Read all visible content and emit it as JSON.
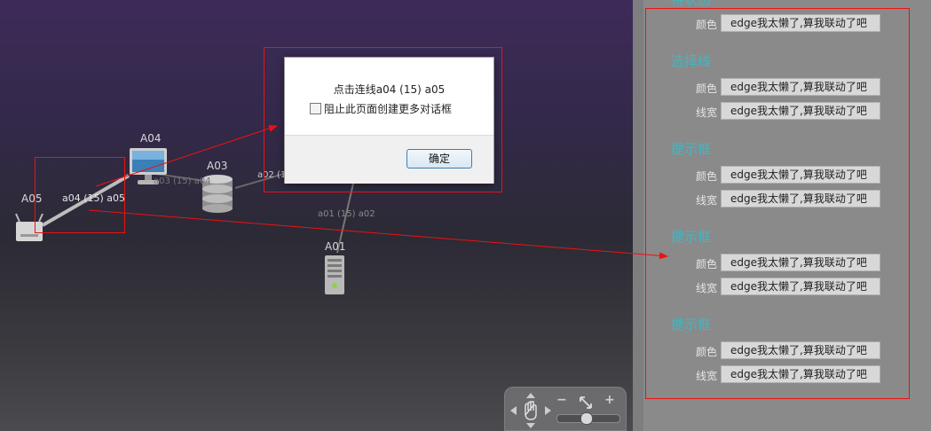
{
  "topology": {
    "nodes": [
      {
        "id": "A04",
        "label": "A04",
        "icon": "monitor-icon"
      },
      {
        "id": "A03",
        "label": "A03",
        "icon": "database-icon"
      },
      {
        "id": "A05",
        "label": "A05",
        "icon": "router-icon"
      },
      {
        "id": "A01",
        "label": "A01",
        "icon": "server-icon"
      }
    ],
    "links": {
      "a04_a05": "a04 (15) a05",
      "a03_a04": "a03 (15) a04",
      "a02_partial": "a02 (1",
      "a01_a02": "a01 (15) a02"
    },
    "zoom": {
      "minus": "−",
      "plus": "+",
      "level": 0.45
    }
  },
  "dialog": {
    "message": "点击连线a04 (15) a05",
    "checkbox_label": "阻止此页面创建更多对话框",
    "ok_label": "确定"
  },
  "panel": {
    "top_partial_title": "待状态",
    "rows_group0": [
      {
        "label": "颜色",
        "value": "edge我太懒了,算我联动了吧"
      }
    ],
    "groups": [
      {
        "title": "选择线",
        "rows": [
          {
            "label": "颜色",
            "value": "edge我太懒了,算我联动了吧"
          },
          {
            "label": "线宽",
            "value": "edge我太懒了,算我联动了吧"
          }
        ]
      },
      {
        "title": "提示框",
        "rows": [
          {
            "label": "颜色",
            "value": "edge我太懒了,算我联动了吧"
          },
          {
            "label": "线宽",
            "value": "edge我太懒了,算我联动了吧"
          }
        ]
      },
      {
        "title": "提示框",
        "rows": [
          {
            "label": "颜色",
            "value": "edge我太懒了,算我联动了吧"
          },
          {
            "label": "线宽",
            "value": "edge我太懒了,算我联动了吧"
          }
        ]
      },
      {
        "title": "提示框",
        "rows": [
          {
            "label": "颜色",
            "value": "edge我太懒了,算我联动了吧"
          },
          {
            "label": "线宽",
            "value": "edge我太懒了,算我联动了吧"
          }
        ]
      }
    ]
  },
  "colors": {
    "annotation": "#ee1111",
    "panel_title": "#3fb8c4"
  }
}
